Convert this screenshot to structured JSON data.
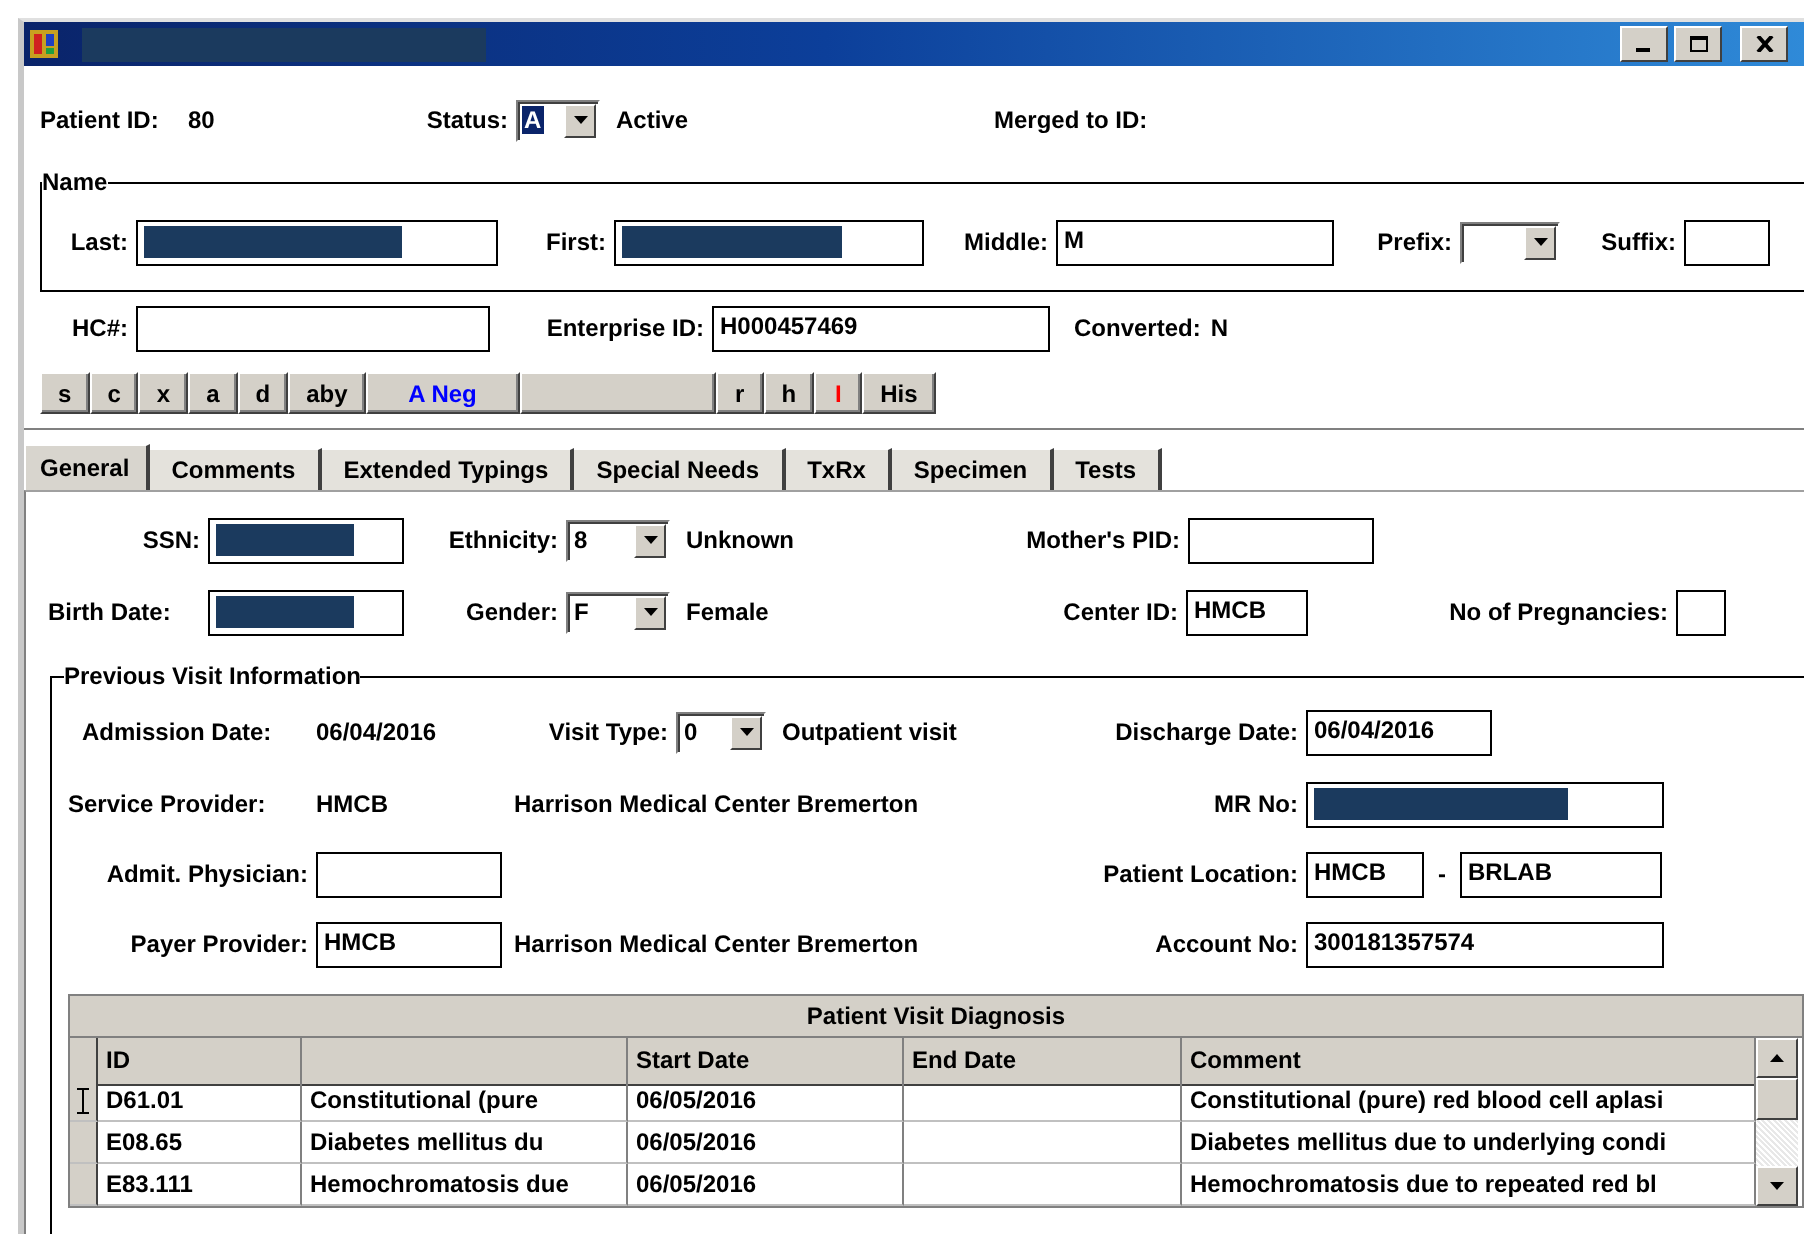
{
  "window": {
    "title_redacted": true
  },
  "header": {
    "patient_id": {
      "label": "Patient ID:",
      "value": "80"
    },
    "status": {
      "label": "Status:",
      "value": "A",
      "focused": true,
      "description": "Active"
    },
    "merged": {
      "label": "Merged to ID:"
    }
  },
  "name_group": {
    "title": "Name",
    "fields": [
      {
        "kind": "text",
        "label": "Last:",
        "redacted": true
      },
      {
        "kind": "text",
        "label": "First:",
        "redacted": true
      },
      {
        "kind": "text",
        "label": "Middle:",
        "value": "M"
      },
      {
        "kind": "combo",
        "label": "Prefix:"
      },
      {
        "kind": "text",
        "label": "Suffix:"
      }
    ]
  },
  "id_row": {
    "fields": [
      {
        "label": "HC#:"
      },
      {
        "label": "Enterprise ID:",
        "value": "H000457469"
      }
    ],
    "converted": {
      "label": "Converted:",
      "value": "N"
    }
  },
  "quick_buttons": [
    {
      "kind": "letter",
      "label": "s",
      "color": "#000000"
    },
    {
      "kind": "letter",
      "label": "c",
      "color": "#000000"
    },
    {
      "kind": "letter",
      "label": "x",
      "color": "#000000"
    },
    {
      "kind": "letter",
      "label": "a",
      "color": "#000000"
    },
    {
      "kind": "letter",
      "label": "d",
      "color": "#000000"
    },
    {
      "kind": "letter",
      "label": "aby",
      "color": "#000000"
    },
    {
      "kind": "wide",
      "label": "A Neg",
      "color": "#0000ff"
    },
    {
      "kind": "blank"
    },
    {
      "kind": "letter",
      "label": "r",
      "color": "#000000"
    },
    {
      "kind": "letter",
      "label": "h",
      "color": "#000000"
    },
    {
      "kind": "letter",
      "label": "I",
      "color": "#ff0000"
    },
    {
      "kind": "letter",
      "label": "His",
      "color": "#000000"
    }
  ],
  "tabs": [
    {
      "label": "General",
      "selected": true
    },
    {
      "label": "Comments",
      "selected": false
    },
    {
      "label": "Extended Typings",
      "selected": false
    },
    {
      "label": "Special Needs",
      "selected": false
    },
    {
      "label": "TxRx",
      "selected": false
    },
    {
      "label": "Specimen",
      "selected": false
    },
    {
      "label": "Tests",
      "selected": false
    }
  ],
  "general": {
    "ssn": {
      "label": "SSN:",
      "redacted": true
    },
    "ethnicity": {
      "label": "Ethnicity:",
      "value": "8",
      "description": "Unknown"
    },
    "mothers_pid": {
      "label": "Mother's PID:"
    },
    "birth_date": {
      "label": "Birth Date:",
      "redacted": true
    },
    "gender": {
      "label": "Gender:",
      "value": "F",
      "description": "Female"
    },
    "center_id": {
      "label": "Center ID:",
      "value": "HMCB"
    },
    "pregnancies": {
      "label": "No of Pregnancies:"
    }
  },
  "visit": {
    "title": "Previous Visit Information",
    "admission_date": {
      "label": "Admission Date:",
      "value": "06/04/2016"
    },
    "visit_type": {
      "label": "Visit Type:",
      "value": "0",
      "description": "Outpatient visit"
    },
    "discharge_date": {
      "label": "Discharge Date:",
      "value": "06/04/2016"
    },
    "service_provider": {
      "label": "Service Provider:",
      "value": "HMCB",
      "description": "Harrison Medical Center Bremerton"
    },
    "mr_no": {
      "label": "MR No:",
      "redacted": true
    },
    "admit_physician": {
      "label": "Admit. Physician:"
    },
    "patient_location": {
      "label": "Patient Location:",
      "value": "HMCB",
      "separator": "-",
      "value_2": "BRLAB"
    },
    "payer_provider": {
      "label": "Payer Provider:",
      "value": "HMCB",
      "description": "Harrison Medical Center Bremerton"
    },
    "account_no": {
      "label": "Account No:",
      "value": "300181357574"
    }
  },
  "diagnosis": {
    "title": "Patient Visit Diagnosis",
    "columns": [
      "ID",
      null,
      "Start Date",
      "End Date",
      "Comment"
    ],
    "rows": [
      {
        "cursor": true,
        "cells": [
          "D61.01",
          "Constitutional (pure",
          "06/05/2016",
          null,
          "Constitutional (pure) red blood cell aplasi"
        ]
      },
      {
        "cursor": false,
        "cells": [
          "E08.65",
          "Diabetes mellitus du",
          "06/05/2016",
          null,
          "Diabetes mellitus due to underlying condi"
        ]
      },
      {
        "cursor": false,
        "cells": [
          "E83.111",
          "Hemochromatosis due",
          "06/05/2016",
          null,
          "Hemochromatosis due to repeated red bl"
        ]
      }
    ]
  }
}
